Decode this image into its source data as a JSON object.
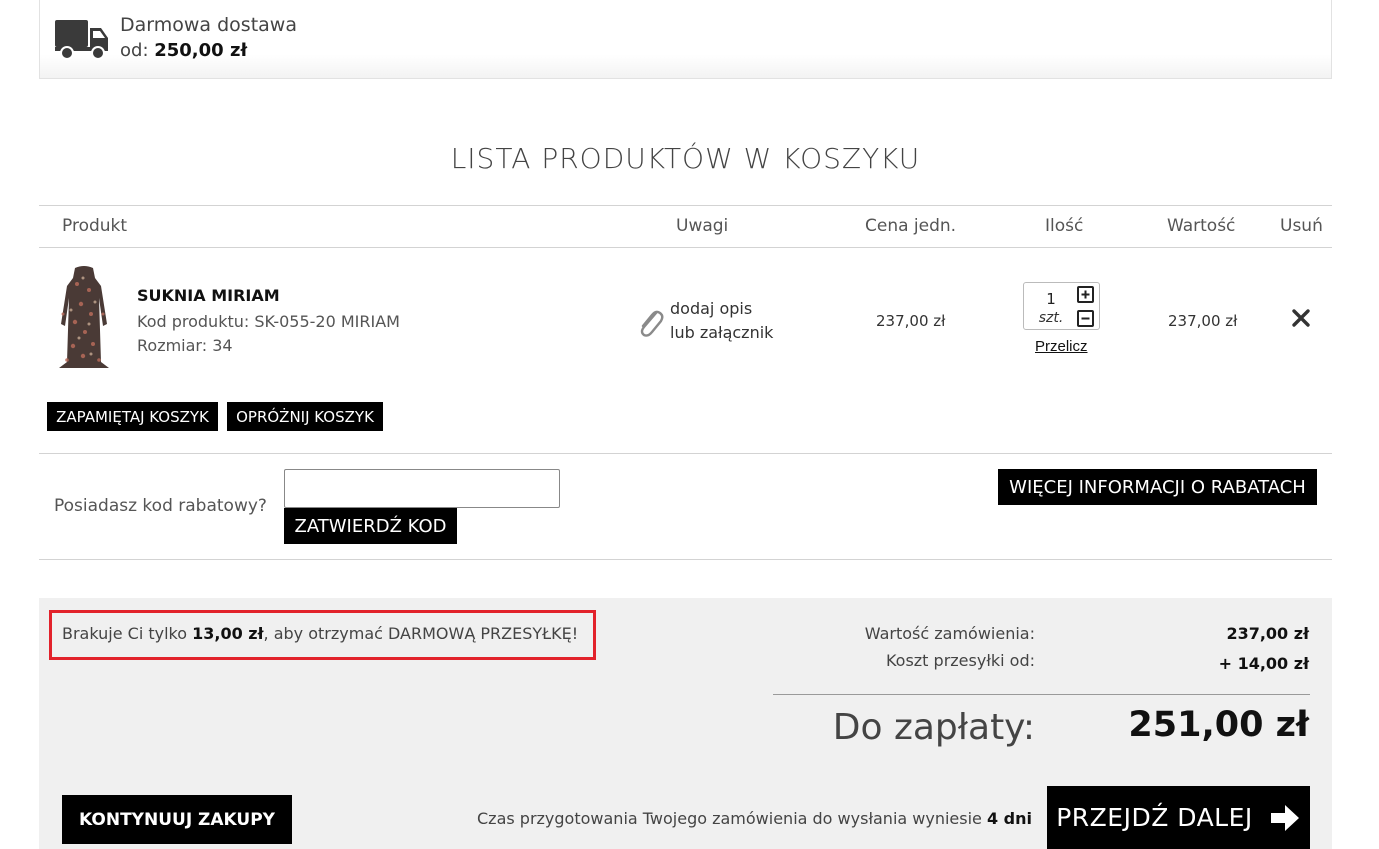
{
  "banner": {
    "line1": "Darmowa dostawa",
    "line2_prefix": "od: ",
    "line2_value": "250,00 zł",
    "icon": "truck-icon"
  },
  "title": "LISTA PRODUKTÓW W KOSZYKU",
  "table": {
    "headers": {
      "product": "Produkt",
      "notes": "Uwagi",
      "unit_price": "Cena jedn.",
      "quantity": "Ilość",
      "value": "Wartość",
      "remove": "Usuń"
    },
    "rows": [
      {
        "name": "SUKNIA MIRIAM",
        "code": "Kod produktu: SK-055-20 MIRIAM",
        "size": "Rozmiar: 34",
        "note_line1": "dodaj opis",
        "note_line2": "lub załącznik",
        "unit_price": "237,00 zł",
        "quantity": "1",
        "unit": "szt.",
        "recalc": "Przelicz",
        "value": "237,00 zł"
      }
    ]
  },
  "cart_buttons": {
    "save": "ZAPAMIĘTAJ KOSZYK",
    "empty": "OPRÓŻNIJ KOSZYK"
  },
  "promo": {
    "label": "Posiadasz kod rabatowy?",
    "input_value": "",
    "confirm": "ZATWIERDŹ KOD",
    "more_info": "WIĘCEJ INFORMACJI O RABATACH"
  },
  "summary": {
    "alert_prefix": "Brakuje Ci tylko ",
    "alert_amount": "13,00 zł",
    "alert_suffix": ", aby otrzymać DARMOWĄ PRZESYŁKĘ!",
    "order_value_label": "Wartość zamówienia:",
    "order_value": "237,00 zł",
    "shipping_label": "Koszt przesyłki od:",
    "shipping_value": "+ 14,00 zł",
    "total_label": "Do zapłaty:",
    "total_value": "251,00 zł"
  },
  "footer": {
    "continue": "KONTYNUUJ ZAKUPY",
    "prep_prefix": "Czas przygotowania Twojego zamówienia do wysłania wyniesie ",
    "prep_days": "4 dni",
    "next": "PRZEJDŹ DALEJ"
  },
  "colors": {
    "alert_border": "#e2222b",
    "button_bg": "#000000",
    "summary_bg": "#f0f0f0"
  }
}
